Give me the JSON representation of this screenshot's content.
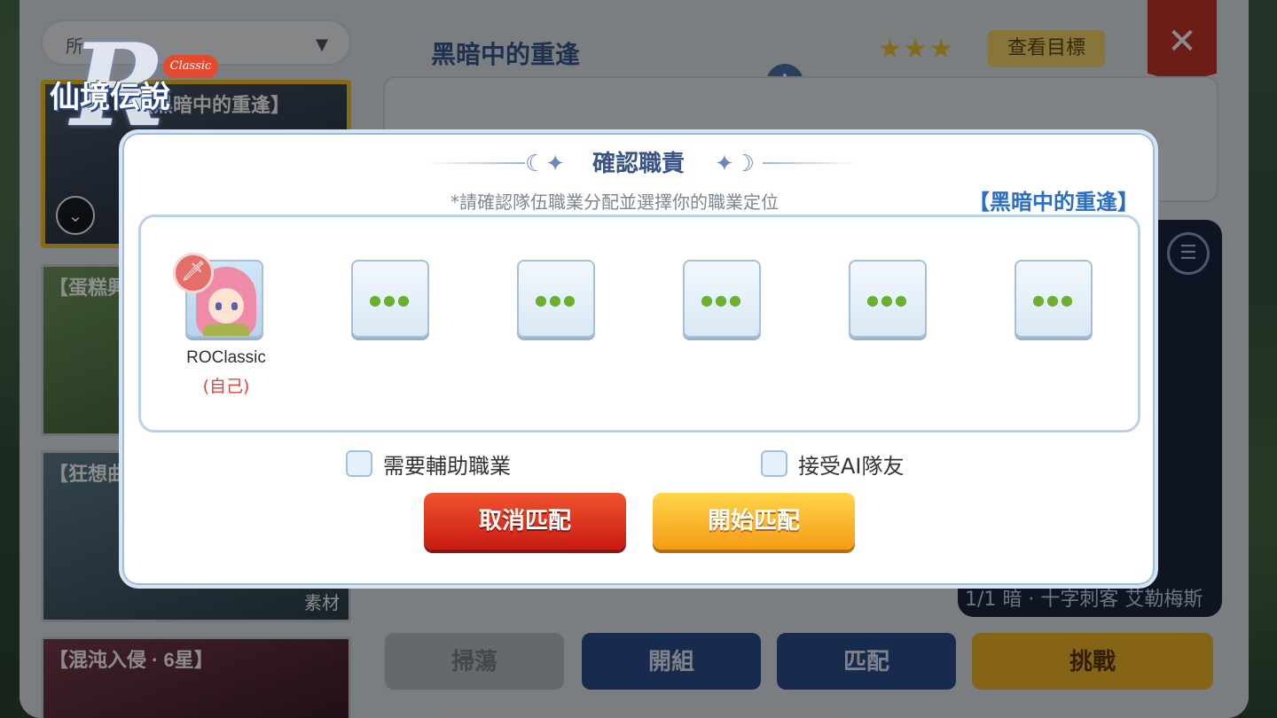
{
  "background": {
    "logo": {
      "mark": "R",
      "name": "仙境伝說",
      "badge": "Classic"
    },
    "left_list": {
      "dropdown_value": "所",
      "cards": [
        {
          "title": "【黑暗中的重逢】",
          "selected": true
        },
        {
          "title": "【蛋糕興",
          "tag": ""
        },
        {
          "title": "【狂想曲",
          "tag": "素材"
        },
        {
          "title": "【混沌入侵 · 6星】"
        }
      ]
    },
    "detail": {
      "title": "黑暗中的重逢",
      "stars": "★★★",
      "view_goal_button": "查看目標",
      "close_label": "✕",
      "boss_line": "1/1 暗 · 十字刺客 艾勒梅斯"
    },
    "actions": {
      "sweep": "掃蕩",
      "group": "開組",
      "match": "匹配",
      "challenge": "挑戰"
    }
  },
  "modal": {
    "title": "確認職責",
    "subtitle": "*請確認隊伍職業分配並選擇你的職業定位",
    "dungeon_name": "【黑暗中的重逢】",
    "self_slot": {
      "player_name": "ROClassic",
      "self_label": "(自己)",
      "role_icon": "sword-icon"
    },
    "empty_slot_dots": "●●●",
    "options": {
      "need_support": "需要輔助職業",
      "accept_ai": "接受AI隊友"
    },
    "buttons": {
      "cancel": "取消匹配",
      "start": "開始匹配"
    }
  },
  "colors": {
    "accent_blue": "#2a6fc4",
    "cancel_red": "#c81b12",
    "start_orange": "#f59b16",
    "self_red": "#e0453a"
  }
}
